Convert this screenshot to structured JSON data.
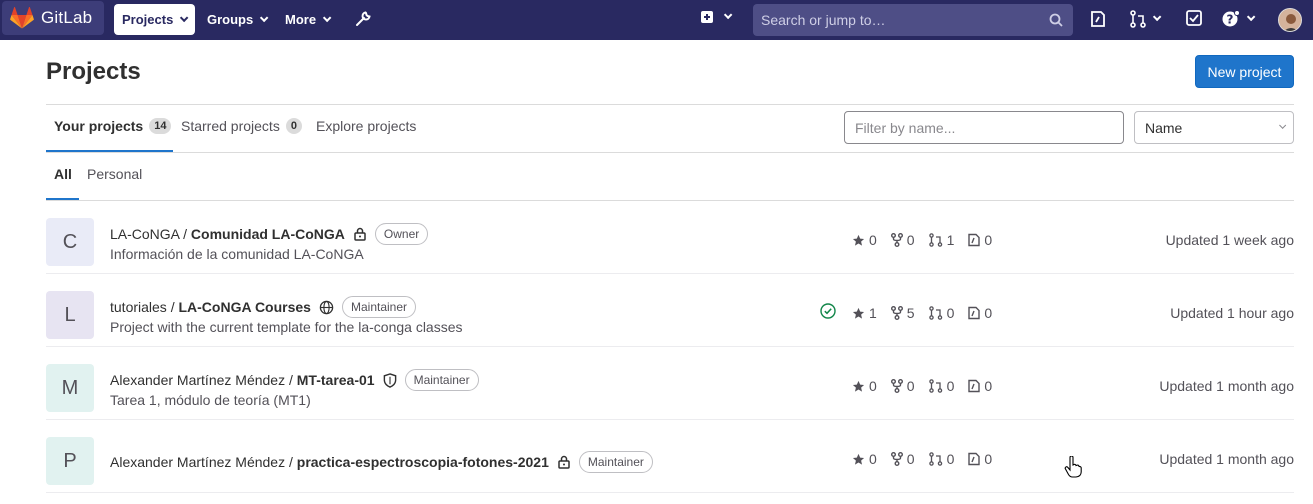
{
  "navbar": {
    "brand": "GitLab",
    "projects": "Projects",
    "groups": "Groups",
    "more": "More",
    "search_placeholder": "Search or jump to…",
    "icons": [
      "wrench-icon",
      "plus-square-icon",
      "issues-icon",
      "merge-request-icon",
      "todo-icon",
      "help-icon",
      "user-avatar"
    ]
  },
  "header": {
    "title": "Projects",
    "new_project": "New project"
  },
  "tabs": [
    {
      "label": "Your projects",
      "count": "14"
    },
    {
      "label": "Starred projects",
      "count": "0"
    },
    {
      "label": "Explore projects"
    }
  ],
  "filter": {
    "placeholder": "Filter by name...",
    "sort": "Name"
  },
  "subtabs": [
    "All",
    "Personal"
  ],
  "projects": [
    {
      "avatar": "C",
      "namespace": "LA-CoNGA /",
      "name": "Comunidad LA-CoNGA",
      "visibility_icon": "lock-icon",
      "role": "Owner",
      "description": "Información de la comunidad LA-CoNGA",
      "stars": "0",
      "forks": "0",
      "merge_requests": "1",
      "issues": "0",
      "updated": "Updated 1 week ago"
    },
    {
      "avatar": "L",
      "namespace": "tutoriales /",
      "name": "LA-CoNGA Courses",
      "visibility_icon": "globe-icon",
      "role": "Maintainer",
      "description": "Project with the current template for the la-conga classes",
      "pipeline": "passed",
      "stars": "1",
      "forks": "5",
      "merge_requests": "0",
      "issues": "0",
      "updated": "Updated 1 hour ago"
    },
    {
      "avatar": "M",
      "namespace": "Alexander Martínez Méndez /",
      "name": "MT-tarea-01",
      "visibility_icon": "shield-icon",
      "role": "Maintainer",
      "description": "Tarea 1, módulo de teoría (MT1)",
      "stars": "0",
      "forks": "0",
      "merge_requests": "0",
      "issues": "0",
      "updated": "Updated 1 month ago"
    },
    {
      "avatar": "P",
      "namespace": "Alexander Martínez Méndez /",
      "name": "practica-espectroscopia-fotones-2021",
      "visibility_icon": "lock-icon",
      "role": "Maintainer",
      "description": "",
      "stars": "0",
      "forks": "0",
      "merge_requests": "0",
      "issues": "0",
      "updated": "Updated 1 month ago"
    }
  ],
  "colors": {
    "navbar": "#292961",
    "primary": "#1f75cb",
    "pipeline_success": "#108548"
  }
}
